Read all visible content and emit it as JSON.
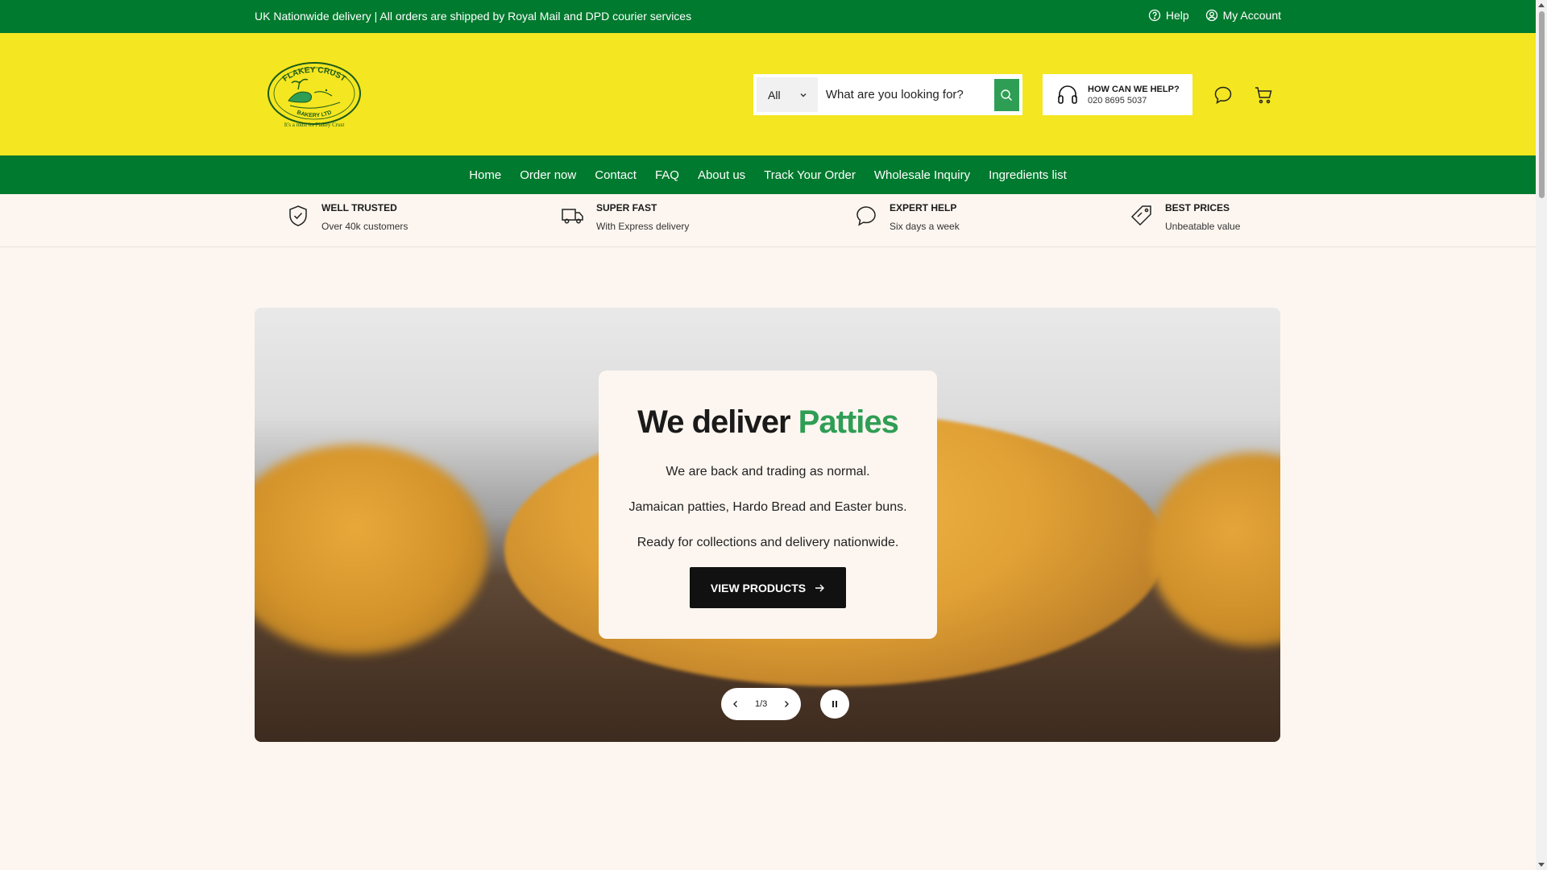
{
  "announcement": {
    "text": "UK Nationwide delivery | All orders are shipped by Royal Mail and DPD courier services",
    "help_label": "Help",
    "account_label": "My Account"
  },
  "header": {
    "logo": {
      "name": "FLAKEY CRUST",
      "sub": "BAKERY LTD",
      "tagline": "It's a must its Flakey Crust"
    },
    "search": {
      "category": "All",
      "placeholder": "What are you looking for?"
    },
    "help_box": {
      "title": "HOW CAN WE HELP?",
      "phone": "020 8695 5037"
    }
  },
  "nav": {
    "items": [
      "Home",
      "Order now",
      "Contact",
      "FAQ",
      "About us",
      "Track Your Order",
      "Wholesale Inquiry",
      "Ingredients list"
    ]
  },
  "features": [
    {
      "title": "WELL TRUSTED",
      "subtitle": "Over 40k customers",
      "icon": "shield-check-icon"
    },
    {
      "title": "SUPER FAST",
      "subtitle": "With Express delivery",
      "icon": "truck-icon"
    },
    {
      "title": "EXPERT HELP",
      "subtitle": "Six days a week",
      "icon": "chat-icon"
    },
    {
      "title": "BEST PRICES",
      "subtitle": "Unbeatable value",
      "icon": "price-tag-icon"
    }
  ],
  "hero": {
    "title_lead": "We deliver",
    "title_accent": "Patties",
    "lines": [
      "We are back and trading as normal.",
      "Jamaican patties, Hardo Bread and Easter buns.",
      "Ready for collections and delivery nationwide."
    ],
    "cta_label": "VIEW PRODUCTS",
    "slide_counter": "1/3"
  },
  "colors": {
    "brand_green": "#007a2e",
    "header_yellow": "#f4e620",
    "accent_green": "#2f9e55",
    "background": "#fdf6f0"
  }
}
